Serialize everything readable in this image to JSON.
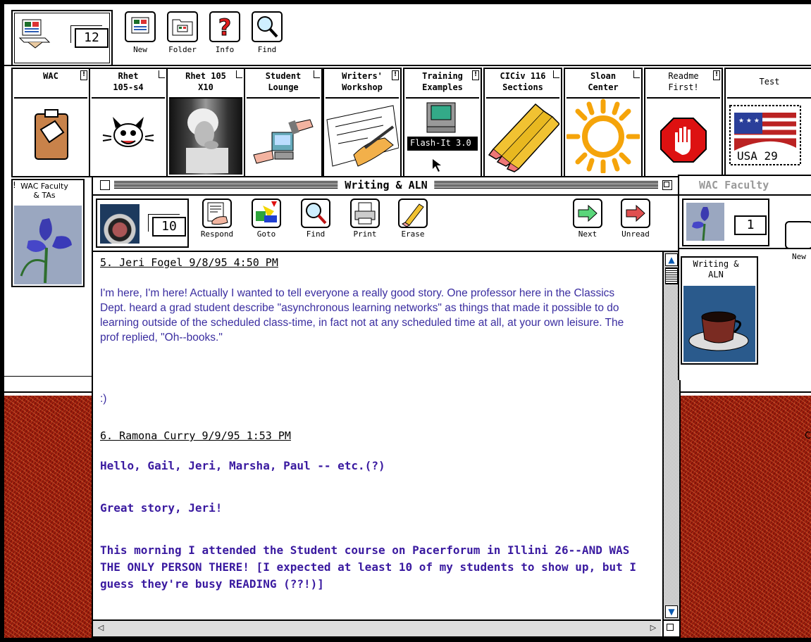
{
  "top_toolbar": {
    "count": "12",
    "buttons": [
      {
        "label": "New",
        "icon": "new-document-icon"
      },
      {
        "label": "Folder",
        "icon": "folder-icon"
      },
      {
        "label": "Info",
        "icon": "question-mark-icon"
      },
      {
        "label": "Find",
        "icon": "magnifier-icon"
      }
    ]
  },
  "folders": [
    {
      "line1": "WAC",
      "line2": "",
      "flag": "!",
      "pic": "clipboard-icon"
    },
    {
      "line1": "Rhet",
      "line2": "105-s4",
      "flag": "",
      "pic": "cat-cartoon-icon"
    },
    {
      "line1": "Rhet 105",
      "line2": "X10",
      "flag": "",
      "pic": "einstein-photo"
    },
    {
      "line1": "Student",
      "line2": "Lounge",
      "flag": "",
      "pic": "computer-hands-icon"
    },
    {
      "line1": "Writers'",
      "line2": "Workshop",
      "flag": "!",
      "pic": "writing-hand-icon"
    },
    {
      "line1": "Training",
      "line2": "Examples",
      "flag": "!",
      "pic": "flash-it-computer-icon",
      "caption": "Flash-It 3.0"
    },
    {
      "line1": "CICiv 116",
      "line2": "Sections",
      "flag": "",
      "pic": "pencils-icon"
    },
    {
      "line1": "Sloan",
      "line2": "Center",
      "flag": "",
      "pic": "sun-icon"
    },
    {
      "line1": "Readme",
      "line2": "First!",
      "flag": "!",
      "pic": "stop-hand-icon"
    },
    {
      "line1": "Test",
      "line2": "",
      "flag": "",
      "pic": "usa-stamp-icon",
      "caption": "USA 29"
    }
  ],
  "side_folder": {
    "line1": "WAC Faculty",
    "line2": "& TAs",
    "flag": "!"
  },
  "aln_window": {
    "title": "Writing & ALN",
    "count": "10",
    "buttons": {
      "respond": "Respond",
      "goto": "Goto",
      "find": "Find",
      "print": "Print",
      "erase": "Erase",
      "next": "Next",
      "unread": "Unread"
    },
    "posts": {
      "p5_header": "5. Jeri Fogel    9/8/95  4:50 PM",
      "p5_body": "I'm here, I'm here!  Actually I wanted to tell everyone a really good story.  One professor here in the Classics Dept. heard a grad student describe \"asynchronous learning networks\" as things that made it possible to do learning outside of the scheduled class-time, in fact not at any scheduled time at all, at your own leisure.  The prof replied, \"Oh--books.\"",
      "p5_smiley": ":)",
      "p6_header": "6. Ramona Curry     9/9/95  1:53 PM",
      "p6_line1": "Hello, Gail, Jeri, Marsha, Paul -- etc.(?)",
      "p6_line2": "Great story, Jeri!",
      "p6_line3": "This morning I attended the Student course on Pacerforum in Illini 26--AND WAS THE ONLY PERSON THERE!  [I expected at least 10 of my students to show up, but I guess they're busy READING (??!)]"
    }
  },
  "wac_window": {
    "title": "WAC Faculty",
    "count": "1",
    "new_label": "New",
    "subfolder": {
      "line1": "Writing &",
      "line2": "ALN"
    }
  },
  "edge_char": "C",
  "colors": {
    "desktop": "#9b1c0c",
    "post_text": "#3a2da0",
    "next_arrow": "#5ad67a",
    "unread_arrow": "#e05050"
  }
}
